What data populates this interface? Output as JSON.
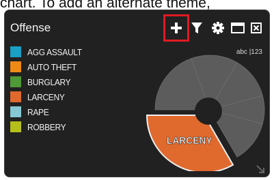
{
  "caption_text": "chart. To add an alternate theme,",
  "widget": {
    "title": "Offense",
    "display_toggle": "abc |123",
    "center_label": "LARCENY"
  },
  "toolbar": {
    "icons": [
      "plus-icon",
      "filter-icon",
      "gear-icon",
      "maximize-icon",
      "close-icon"
    ]
  },
  "legend": [
    {
      "label": "AGG ASSAULT",
      "color": "#1a9fc5"
    },
    {
      "label": "AUTO THEFT",
      "color": "#f08a16"
    },
    {
      "label": "BURGLARY",
      "color": "#4f9a37"
    },
    {
      "label": "LARCENY",
      "color": "#e0692e"
    },
    {
      "label": "RAPE",
      "color": "#85c7d3"
    },
    {
      "label": "ROBBERY",
      "color": "#b5bf1a"
    }
  ],
  "chart_data": {
    "type": "pie",
    "style": "donut",
    "categories": [
      "AGG ASSAULT",
      "AUTO THEFT",
      "BURGLARY",
      "LARCENY",
      "RAPE",
      "ROBBERY"
    ],
    "highlighted": "LARCENY",
    "highlight_color": "#e0692e",
    "dimmed_color": "#5c5c5c",
    "legend_position": "left"
  },
  "colors": {
    "highlight_box": "#e11b22",
    "panel_background": "#212121"
  }
}
